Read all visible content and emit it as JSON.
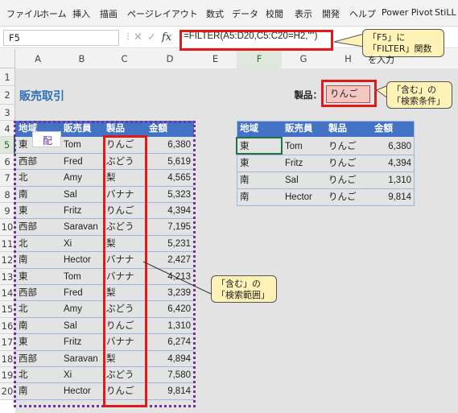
{
  "menu": [
    "ファイル",
    "ホーム",
    "挿入",
    "描画",
    "ページレイアウト",
    "数式",
    "データ",
    "校閲",
    "表示",
    "開発",
    "ヘルプ",
    "Power Pivot",
    "StiLL"
  ],
  "formula_bar": {
    "name_box": "F5",
    "formula": "=FILTER(A5:D20,C5:C20=H2,\"\")"
  },
  "columns": [
    "A",
    "B",
    "C",
    "D",
    "E",
    "F",
    "G",
    "H"
  ],
  "rows": [
    "1",
    "2",
    "3",
    "4",
    "5",
    "6",
    "7",
    "8",
    "9",
    "10",
    "11",
    "12",
    "13",
    "14",
    "15",
    "16",
    "17",
    "18",
    "19",
    "20"
  ],
  "sheet": {
    "title": "販売取引",
    "product_label": "製品：",
    "product_value": "りんご",
    "headers": [
      "地域",
      "販売員",
      "製品",
      "金額"
    ],
    "data": [
      [
        "東",
        "Tom",
        "りんご",
        "6,380"
      ],
      [
        "西部",
        "Fred",
        "ぶどう",
        "5,619"
      ],
      [
        "北",
        "Amy",
        "梨",
        "4,565"
      ],
      [
        "南",
        "Sal",
        "バナナ",
        "5,323"
      ],
      [
        "東",
        "Fritz",
        "りんご",
        "4,394"
      ],
      [
        "西部",
        "Saravan",
        "ぶどう",
        "7,195"
      ],
      [
        "北",
        "Xi",
        "梨",
        "5,231"
      ],
      [
        "南",
        "Hector",
        "バナナ",
        "2,427"
      ],
      [
        "東",
        "Tom",
        "バナナ",
        "4,213"
      ],
      [
        "西部",
        "Fred",
        "梨",
        "3,239"
      ],
      [
        "北",
        "Amy",
        "ぶどう",
        "6,420"
      ],
      [
        "南",
        "Sal",
        "りんご",
        "1,310"
      ],
      [
        "東",
        "Fritz",
        "バナナ",
        "6,274"
      ],
      [
        "西部",
        "Saravan",
        "梨",
        "4,894"
      ],
      [
        "北",
        "Xi",
        "ぶどう",
        "7,580"
      ],
      [
        "南",
        "Hector",
        "りんご",
        "9,814"
      ]
    ],
    "results": [
      [
        "東",
        "Tom",
        "りんご",
        "6,380"
      ],
      [
        "東",
        "Fritz",
        "りんご",
        "4,394"
      ],
      [
        "南",
        "Sal",
        "りんご",
        "1,310"
      ],
      [
        "南",
        "Hector",
        "りんご",
        "9,814"
      ]
    ],
    "overlay_char": "配"
  },
  "callouts": {
    "formula_note": "「F5」に「FILTER」関数を入力",
    "criteria_note": "「含む」の「検索条件」",
    "range_note": "「含む」の「検索範囲」"
  },
  "colors": {
    "table_header": "#4472c4",
    "highlight_red": "#e01a1a",
    "dotted_purple": "#7030a0",
    "callout_fill": "#fff2b6",
    "product_fill": "#f4c7c3"
  }
}
